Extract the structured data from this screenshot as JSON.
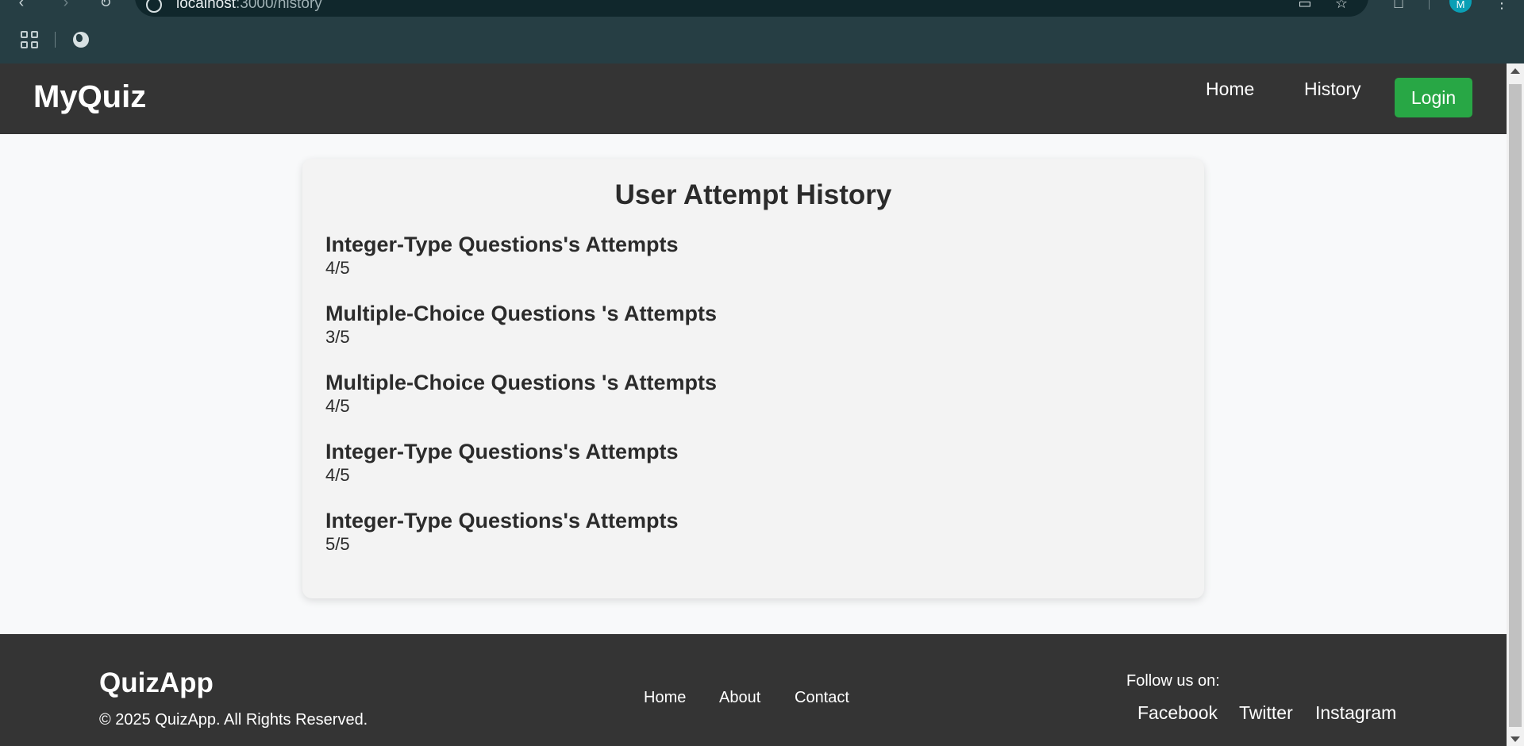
{
  "browser": {
    "url_host": "localhost",
    "url_rest": ":3000/history",
    "profile_initial": "M"
  },
  "navbar": {
    "brand": "MyQuiz",
    "links": [
      {
        "label": "Home"
      },
      {
        "label": "History"
      }
    ],
    "login_label": "Login"
  },
  "history": {
    "title": "User Attempt History",
    "attempts": [
      {
        "title": "Integer-Type Questions's Attempts",
        "score": "4/5"
      },
      {
        "title": "Multiple-Choice Questions 's Attempts",
        "score": "3/5"
      },
      {
        "title": "Multiple-Choice Questions 's Attempts",
        "score": "4/5"
      },
      {
        "title": "Integer-Type Questions's Attempts",
        "score": "4/5"
      },
      {
        "title": "Integer-Type Questions's Attempts",
        "score": "5/5"
      }
    ]
  },
  "footer": {
    "brand": "QuizApp",
    "copyright": "© 2025 QuizApp. All Rights Reserved.",
    "links": [
      {
        "label": "Home"
      },
      {
        "label": "About"
      },
      {
        "label": "Contact"
      }
    ],
    "follow_label": "Follow us on:",
    "social": [
      {
        "label": "Facebook"
      },
      {
        "label": "Twitter"
      },
      {
        "label": "Instagram"
      }
    ]
  },
  "colors": {
    "navbar_bg": "#343434",
    "login_green": "#28a745",
    "card_bg": "#f3f3f3",
    "chrome_bg": "#263e44"
  }
}
